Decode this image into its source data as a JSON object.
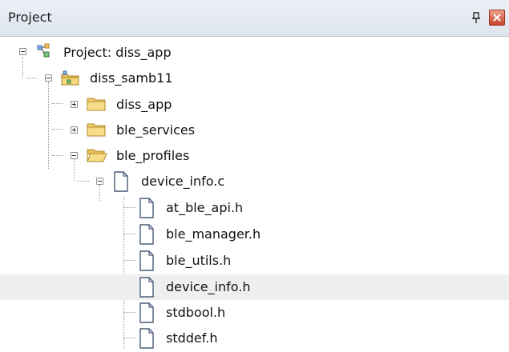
{
  "panel": {
    "title": "Project"
  },
  "tree": {
    "project": {
      "label": "Project: diss_app",
      "icon": "project-icon",
      "expanded": true
    },
    "group": {
      "label": "diss_samb11",
      "icon": "folder-project-icon",
      "expanded": true
    },
    "folders": [
      {
        "label": "diss_app",
        "icon": "folder-icon",
        "expanded": false
      },
      {
        "label": "ble_services",
        "icon": "folder-icon",
        "expanded": false
      },
      {
        "label": "ble_profiles",
        "icon": "folder-open-icon",
        "expanded": true
      }
    ],
    "source_file": {
      "label": "device_info.c",
      "icon": "file-icon",
      "expanded": true
    },
    "headers": [
      {
        "label": "at_ble_api.h",
        "icon": "file-icon"
      },
      {
        "label": "ble_manager.h",
        "icon": "file-icon"
      },
      {
        "label": "ble_utils.h",
        "icon": "file-icon"
      },
      {
        "label": "device_info.h",
        "icon": "file-icon",
        "selected": true
      },
      {
        "label": "stdbool.h",
        "icon": "file-icon"
      },
      {
        "label": "stddef.h",
        "icon": "file-icon"
      }
    ]
  }
}
